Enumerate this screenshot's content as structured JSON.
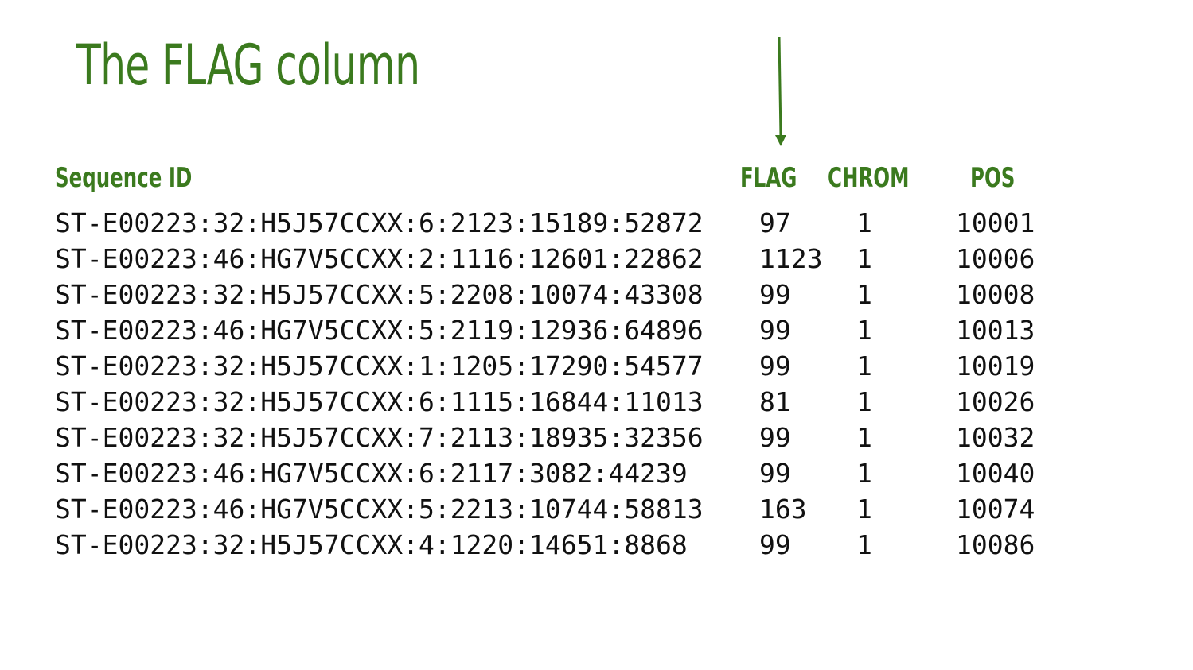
{
  "slide": {
    "title": "The FLAG column",
    "accent_color": "#3b7a1e",
    "arrow_icon": "down-arrow"
  },
  "table": {
    "headers": {
      "sequence_id": "Sequence ID",
      "flag": "FLAG",
      "chrom": "CHROM",
      "pos": "POS"
    },
    "rows": [
      {
        "seq": "ST-E00223:32:H5J57CCXX:6:2123:15189:52872",
        "flag": "97",
        "chrom": "1",
        "pos": "10001"
      },
      {
        "seq": "ST-E00223:46:HG7V5CCXX:2:1116:12601:22862",
        "flag": "1123",
        "chrom": "1",
        "pos": "10006"
      },
      {
        "seq": "ST-E00223:32:H5J57CCXX:5:2208:10074:43308",
        "flag": "99",
        "chrom": "1",
        "pos": "10008"
      },
      {
        "seq": "ST-E00223:46:HG7V5CCXX:5:2119:12936:64896",
        "flag": "99",
        "chrom": "1",
        "pos": "10013"
      },
      {
        "seq": "ST-E00223:32:H5J57CCXX:1:1205:17290:54577",
        "flag": "99",
        "chrom": "1",
        "pos": "10019"
      },
      {
        "seq": "ST-E00223:32:H5J57CCXX:6:1115:16844:11013",
        "flag": "81",
        "chrom": "1",
        "pos": "10026"
      },
      {
        "seq": "ST-E00223:32:H5J57CCXX:7:2113:18935:32356",
        "flag": "99",
        "chrom": "1",
        "pos": "10032"
      },
      {
        "seq": "ST-E00223:46:HG7V5CCXX:6:2117:3082:44239",
        "flag": "99",
        "chrom": "1",
        "pos": "10040"
      },
      {
        "seq": "ST-E00223:46:HG7V5CCXX:5:2213:10744:58813",
        "flag": "163",
        "chrom": "1",
        "pos": "10074"
      },
      {
        "seq": "ST-E00223:32:H5J57CCXX:4:1220:14651:8868",
        "flag": "99",
        "chrom": "1",
        "pos": "10086"
      }
    ]
  }
}
